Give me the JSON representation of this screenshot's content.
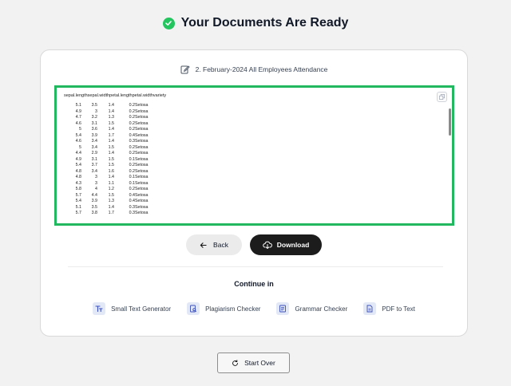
{
  "header": {
    "title": "Your Documents Are Ready",
    "status_color": "#22c55e"
  },
  "file": {
    "name": "2. February-2024 All Employees Attendance",
    "icon": "edit-icon"
  },
  "preview": {
    "header_text": "sepal.lengthsepal.widthpetal.lengthpetal.widthvariety",
    "border_color": "#22b860",
    "rows": [
      [
        "5.1",
        "3.5",
        "1.4",
        "0.2",
        "Setosa"
      ],
      [
        "4.9",
        "3",
        "1.4",
        "0.2",
        "Setosa"
      ],
      [
        "4.7",
        "3.2",
        "1.3",
        "0.2",
        "Setosa"
      ],
      [
        "4.6",
        "3.1",
        "1.5",
        "0.2",
        "Setosa"
      ],
      [
        "5",
        "3.6",
        "1.4",
        "0.2",
        "Setosa"
      ],
      [
        "5.4",
        "3.9",
        "1.7",
        "0.4",
        "Setosa"
      ],
      [
        "4.6",
        "3.4",
        "1.4",
        "0.3",
        "Setosa"
      ],
      [
        "5",
        "3.4",
        "1.5",
        "0.2",
        "Setosa"
      ],
      [
        "4.4",
        "2.9",
        "1.4",
        "0.2",
        "Setosa"
      ],
      [
        "4.9",
        "3.1",
        "1.5",
        "0.1",
        "Setosa"
      ],
      [
        "5.4",
        "3.7",
        "1.5",
        "0.2",
        "Setosa"
      ],
      [
        "4.8",
        "3.4",
        "1.6",
        "0.2",
        "Setosa"
      ],
      [
        "4.8",
        "3",
        "1.4",
        "0.1",
        "Setosa"
      ],
      [
        "4.3",
        "3",
        "1.1",
        "0.1",
        "Setosa"
      ],
      [
        "5.8",
        "4",
        "1.2",
        "0.2",
        "Setosa"
      ],
      [
        "5.7",
        "4.4",
        "1.5",
        "0.4",
        "Setosa"
      ],
      [
        "5.4",
        "3.9",
        "1.3",
        "0.4",
        "Setosa"
      ],
      [
        "5.1",
        "3.5",
        "1.4",
        "0.3",
        "Setosa"
      ],
      [
        "5.7",
        "3.8",
        "1.7",
        "0.3",
        "Setosa"
      ]
    ]
  },
  "actions": {
    "back_label": "Back",
    "download_label": "Download"
  },
  "continue": {
    "title": "Continue in",
    "tools": [
      {
        "label": "Small Text Generator",
        "icon": "text-size-icon"
      },
      {
        "label": "Plagiarism Checker",
        "icon": "plagiarism-icon"
      },
      {
        "label": "Grammar Checker",
        "icon": "grammar-icon"
      },
      {
        "label": "PDF to Text",
        "icon": "pdf-icon"
      }
    ]
  },
  "start_over_label": "Start Over"
}
